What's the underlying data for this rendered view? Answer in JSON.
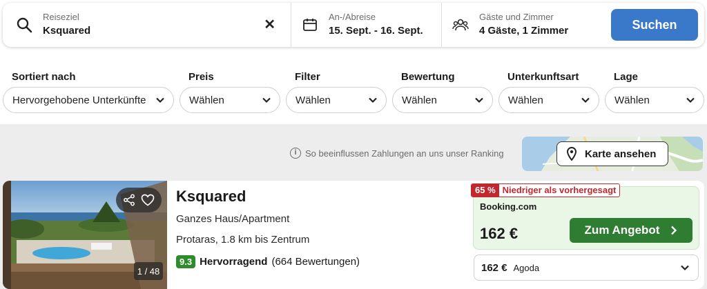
{
  "search": {
    "destination_label": "Reiseziel",
    "destination_value": "Ksquared",
    "clear_symbol": "✕",
    "dates_label": "An-/Abreise",
    "dates_value": "15. Sept. - 16. Sept.",
    "guests_label": "Gäste und Zimmer",
    "guests_value": "4 Gäste, 1 Zimmer",
    "search_button": "Suchen"
  },
  "filters": [
    {
      "label": "Sortiert nach",
      "value": "Hervorgehobene Unterkünfte"
    },
    {
      "label": "Preis",
      "value": "Wählen"
    },
    {
      "label": "Filter",
      "value": "Wählen"
    },
    {
      "label": "Bewertung",
      "value": "Wählen"
    },
    {
      "label": "Unterkunftsart",
      "value": "Wählen"
    },
    {
      "label": "Lage",
      "value": "Wählen"
    }
  ],
  "ranking_note": "So beeinflussen Zahlungen an uns unser Ranking",
  "info_symbol": "i",
  "map_button": "Karte ansehen",
  "hotel": {
    "name": "Ksquared",
    "type": "Ganzes Haus/Apartment",
    "location": "Protaras, 1.8 km bis Zentrum",
    "score": "9.3",
    "rating_word": "Hervorragend",
    "reviews": "(664 Bewertungen)",
    "photo_count": "1 / 48",
    "deal": {
      "badge_percent": "65 %",
      "badge_text": "Niedriger als vorhergesagt",
      "provider": "Booking.com",
      "price": "162 €",
      "button": "Zum Angebot"
    },
    "alt_offer": {
      "price": "162 €",
      "provider": "Agoda"
    }
  },
  "colors": {
    "primary_blue": "#3a79c9",
    "deal_green": "#2e7d32",
    "badge_red": "#c0282e",
    "score_green": "#2e8b2e"
  }
}
